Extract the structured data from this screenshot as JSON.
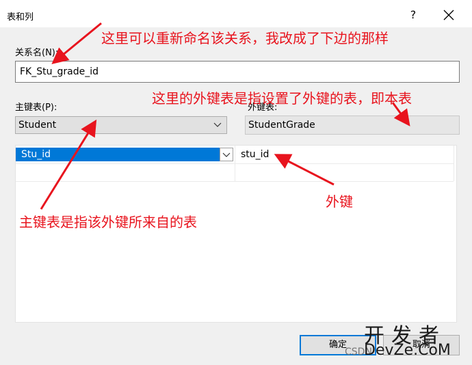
{
  "window": {
    "title": "表和列",
    "help_label": "?"
  },
  "relation": {
    "label": "关系名(N):",
    "value": "FK_Stu_grade_id"
  },
  "primary": {
    "label": "主键表(P):",
    "value": "Student"
  },
  "foreign": {
    "label": "外键表:",
    "value": "StudentGrade"
  },
  "grid": {
    "primary_col": "Stu_id",
    "foreign_col": "stu_id"
  },
  "buttons": {
    "ok": "确定",
    "cancel": "取消"
  },
  "annotations": {
    "top": "这里可以重新命名该关系，我改成了下边的那样",
    "right": "这里的外键表是指设置了外键的表，即本表",
    "fk": "外键",
    "pk": "主键表是指该外键所来自的表"
  },
  "watermark": {
    "main": "开发者",
    "sub": "DevZe.CoM",
    "csdn": "CSDN"
  },
  "colors": {
    "annotation": "#e8141e",
    "selection": "#0078d7"
  }
}
